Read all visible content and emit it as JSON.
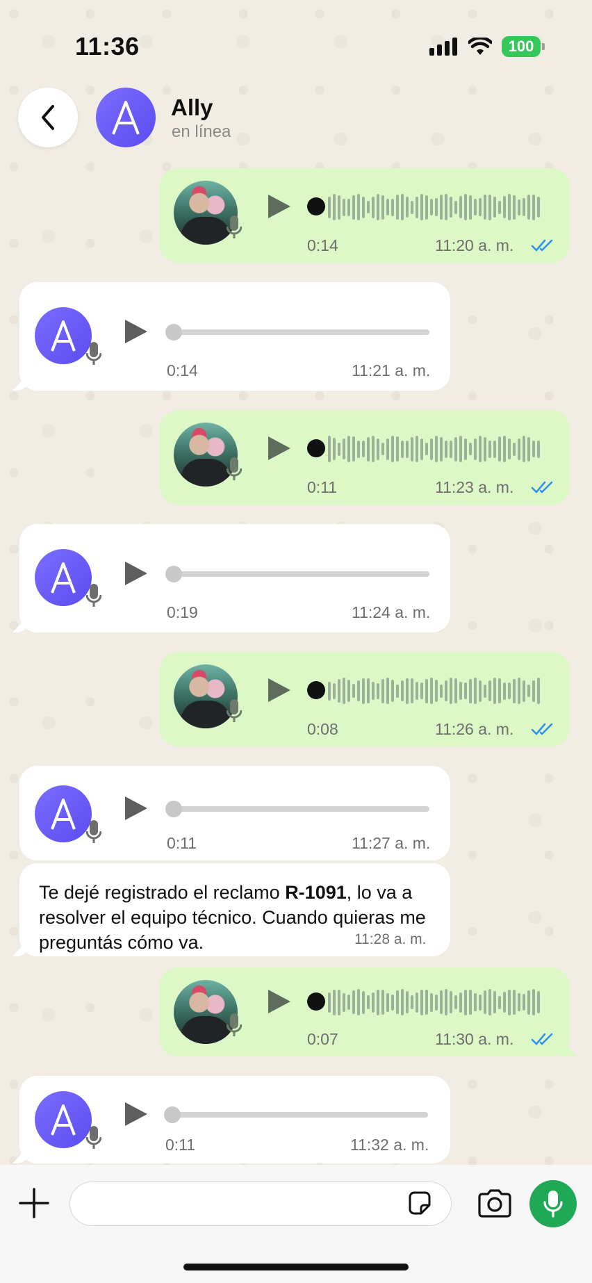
{
  "status_bar": {
    "time": "11:36",
    "battery": "100"
  },
  "header": {
    "contact_name": "Ally",
    "contact_status": "en línea",
    "avatar_letter": "A"
  },
  "messages": [
    {
      "direction": "out",
      "type": "voice",
      "duration": "0:14",
      "time": "11:20 a. m.",
      "read": true
    },
    {
      "direction": "in",
      "type": "voice",
      "duration": "0:14",
      "time": "11:21 a. m."
    },
    {
      "direction": "out",
      "type": "voice",
      "duration": "0:11",
      "time": "11:23 a. m.",
      "read": true
    },
    {
      "direction": "in",
      "type": "voice",
      "duration": "0:19",
      "time": "11:24 a. m."
    },
    {
      "direction": "out",
      "type": "voice",
      "duration": "0:08",
      "time": "11:26 a. m.",
      "read": true
    },
    {
      "direction": "in",
      "type": "voice",
      "duration": "0:11",
      "time": "11:27 a. m."
    },
    {
      "direction": "in",
      "type": "text",
      "text_before": "Te dejé registrado el reclamo ",
      "text_bold": "R-1091",
      "text_after": ", lo va a resolver el equipo técnico. Cuando quieras me preguntás cómo va.",
      "time": "11:28 a. m."
    },
    {
      "direction": "out",
      "type": "voice",
      "duration": "0:07",
      "time": "11:30 a. m.",
      "read": true
    },
    {
      "direction": "in",
      "type": "voice",
      "duration": "0:11",
      "time": "11:32 a. m."
    }
  ],
  "colors": {
    "outgoing_bubble": "#dbf8c6",
    "incoming_bubble": "#ffffff",
    "accent_green": "#1fa855",
    "read_ticks": "#2f8ff0",
    "avatar_purple": "#6a5cff"
  },
  "icons": [
    "back-icon",
    "play-icon",
    "mic-icon",
    "plus-icon",
    "sticker-icon",
    "camera-icon",
    "double-check-icon",
    "wifi-icon",
    "signal-icon"
  ]
}
